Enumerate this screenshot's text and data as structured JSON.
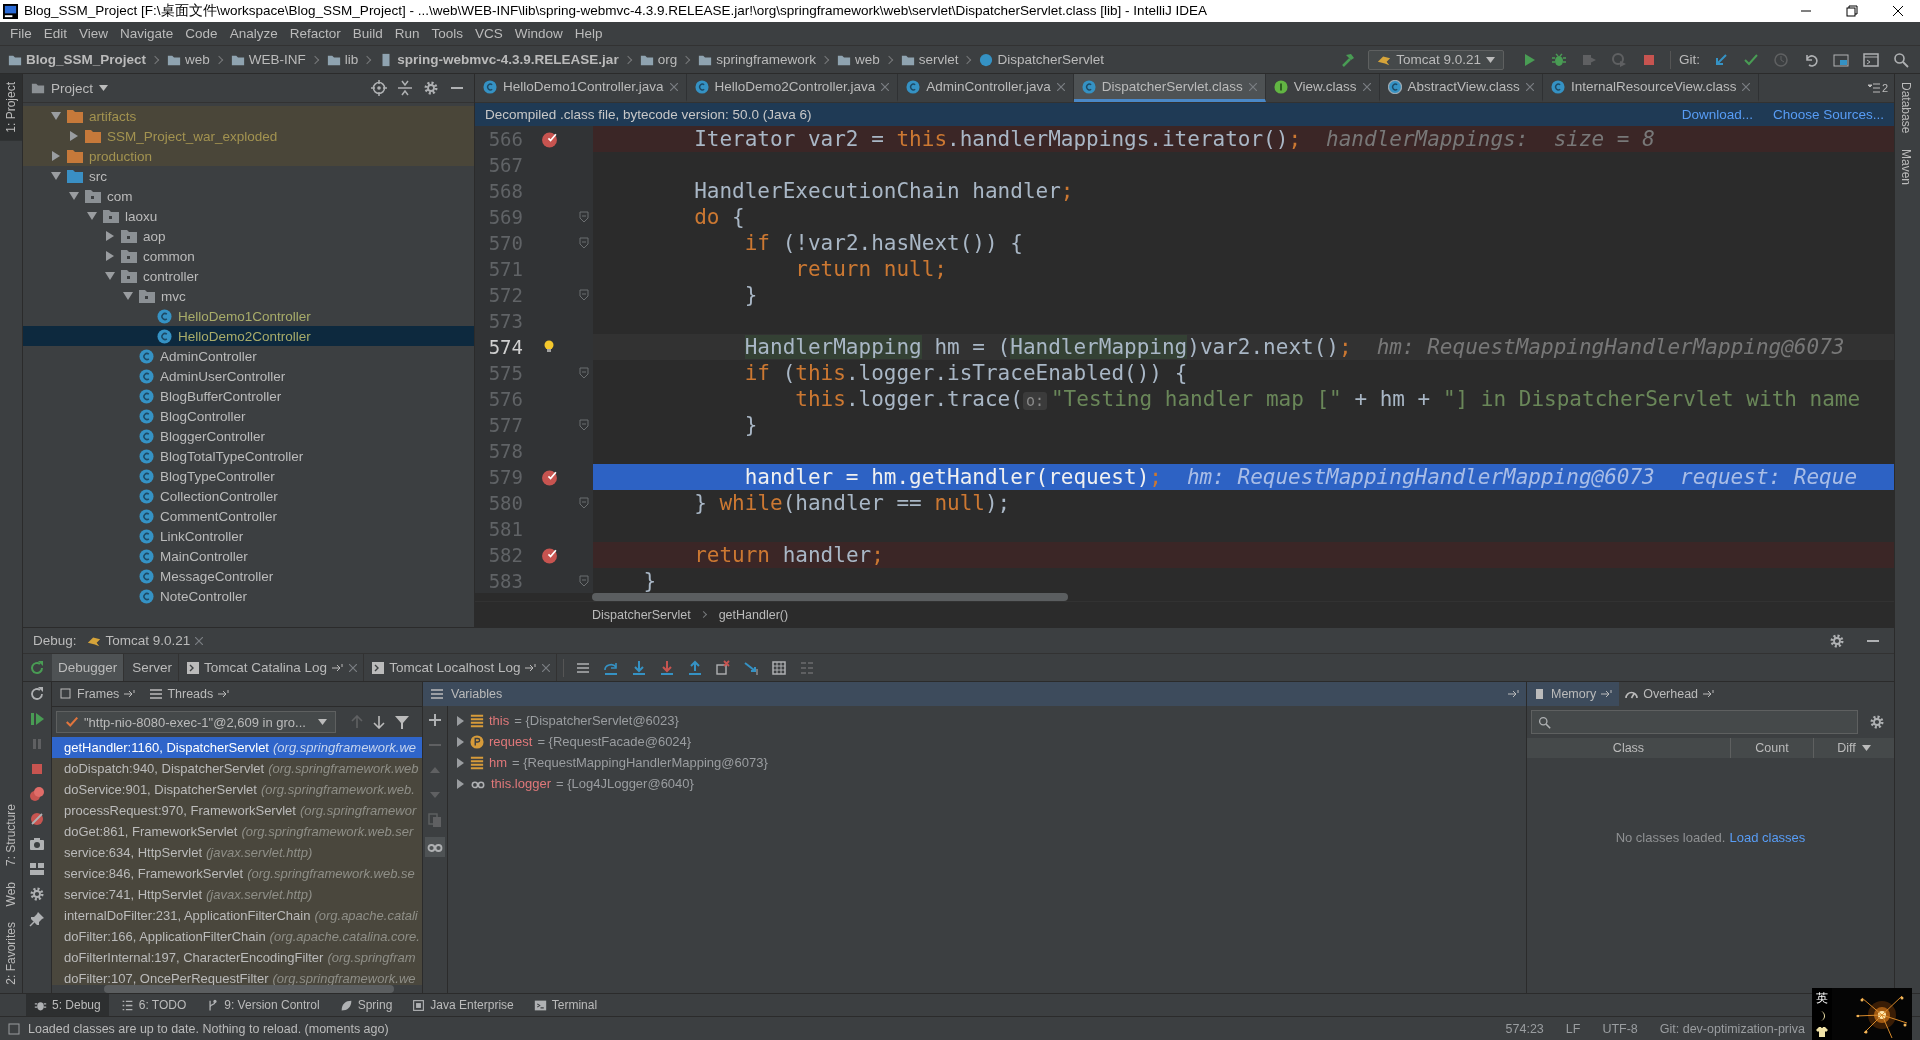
{
  "window": {
    "title": "Blog_SSM_Project [F:\\桌面文件\\workspace\\Blog_SSM_Project] - ...\\web\\WEB-INF\\lib\\spring-webmvc-4.3.9.RELEASE.jar!\\org\\springframework\\web\\servlet\\DispatcherServlet.class [lib] - IntelliJ IDEA"
  },
  "menu": [
    "File",
    "Edit",
    "View",
    "Navigate",
    "Code",
    "Analyze",
    "Refactor",
    "Build",
    "Run",
    "Tools",
    "VCS",
    "Window",
    "Help"
  ],
  "nav_bar": {
    "breadcrumbs": [
      {
        "label": "Blog_SSM_Project",
        "kind": "project"
      },
      {
        "label": "web",
        "kind": "folder"
      },
      {
        "label": "WEB-INF",
        "kind": "folder"
      },
      {
        "label": "lib",
        "kind": "folder"
      },
      {
        "label": "spring-webmvc-4.3.9.RELEASE.jar",
        "kind": "jar"
      },
      {
        "label": "org",
        "kind": "package"
      },
      {
        "label": "springframework",
        "kind": "package"
      },
      {
        "label": "web",
        "kind": "package"
      },
      {
        "label": "servlet",
        "kind": "package"
      },
      {
        "label": "DispatcherServlet",
        "kind": "class"
      }
    ],
    "run_config": "Tomcat 9.0.21",
    "run_actions": [
      {
        "kind": "run",
        "disabled": false
      },
      {
        "kind": "debug",
        "disabled": false
      },
      {
        "kind": "coverage",
        "disabled": true
      },
      {
        "kind": "profile",
        "disabled": true
      },
      {
        "kind": "stop",
        "disabled": false
      }
    ],
    "git_label": "Git:",
    "git_actions": [
      {
        "kind": "update",
        "disabled": false
      },
      {
        "kind": "commit",
        "disabled": false
      },
      {
        "kind": "history",
        "disabled": true
      },
      {
        "kind": "revert",
        "disabled": false
      },
      {
        "kind": "structure",
        "disabled": false
      },
      {
        "kind": "window",
        "disabled": false
      },
      {
        "kind": "search",
        "disabled": false
      }
    ]
  },
  "left_stripe": {
    "top": [
      {
        "label": "1: Project",
        "selected": true
      }
    ],
    "bottom": [
      {
        "label": "7: Structure",
        "selected": false
      },
      {
        "label": "Web",
        "selected": false
      },
      {
        "label": "2: Favorites",
        "selected": false
      }
    ]
  },
  "right_stripe": [
    {
      "label": "Database",
      "selected": false
    },
    {
      "label": "Maven",
      "selected": false
    }
  ],
  "project": {
    "title": "Project",
    "tree": [
      {
        "label": "artifacts",
        "kind": "excluded-folder",
        "expanded": true,
        "selected": false,
        "children": [
          {
            "label": "SSM_Project_war_exploded",
            "kind": "excluded-folder",
            "expanded": false,
            "selected": false
          }
        ]
      },
      {
        "label": "production",
        "kind": "excluded-folder",
        "expanded": false,
        "selected": false
      },
      {
        "label": "src",
        "kind": "source-folder",
        "expanded": true,
        "selected": false,
        "children": [
          {
            "label": "com",
            "kind": "package",
            "expanded": true,
            "selected": false,
            "children": [
              {
                "label": "laoxu",
                "kind": "package",
                "expanded": true,
                "selected": false,
                "children": [
                  {
                    "label": "aop",
                    "kind": "package",
                    "expanded": false,
                    "selected": false
                  },
                  {
                    "label": "common",
                    "kind": "package",
                    "expanded": false,
                    "selected": false
                  },
                  {
                    "label": "controller",
                    "kind": "package",
                    "expanded": true,
                    "selected": false,
                    "children": [
                      {
                        "label": "mvc",
                        "kind": "package",
                        "expanded": true,
                        "selected": false,
                        "children": [
                          {
                            "label": "HelloDemo1Controller",
                            "kind": "class",
                            "changed": true,
                            "selected": false
                          },
                          {
                            "label": "HelloDemo2Controller",
                            "kind": "class",
                            "changed": true,
                            "selected": true
                          }
                        ]
                      },
                      {
                        "label": "AdminController",
                        "kind": "class",
                        "changed": false,
                        "selected": false
                      },
                      {
                        "label": "AdminUserController",
                        "kind": "class",
                        "changed": false,
                        "selected": false
                      },
                      {
                        "label": "BlogBufferController",
                        "kind": "class",
                        "changed": false,
                        "selected": false
                      },
                      {
                        "label": "BlogController",
                        "kind": "class",
                        "changed": false,
                        "selected": false
                      },
                      {
                        "label": "BloggerController",
                        "kind": "class",
                        "changed": false,
                        "selected": false
                      },
                      {
                        "label": "BlogTotalTypeController",
                        "kind": "class",
                        "changed": false,
                        "selected": false
                      },
                      {
                        "label": "BlogTypeController",
                        "kind": "class",
                        "changed": false,
                        "selected": false
                      },
                      {
                        "label": "CollectionController",
                        "kind": "class",
                        "changed": false,
                        "selected": false
                      },
                      {
                        "label": "CommentController",
                        "kind": "class",
                        "changed": false,
                        "selected": false
                      },
                      {
                        "label": "LinkController",
                        "kind": "class",
                        "changed": false,
                        "selected": false
                      },
                      {
                        "label": "MainController",
                        "kind": "class",
                        "changed": false,
                        "selected": false
                      },
                      {
                        "label": "MessageController",
                        "kind": "class",
                        "changed": false,
                        "selected": false
                      },
                      {
                        "label": "NoteController",
                        "kind": "class",
                        "changed": false,
                        "selected": false
                      }
                    ]
                  }
                ]
              }
            ]
          }
        ]
      }
    ]
  },
  "editor": {
    "tabs": [
      {
        "label": "HelloDemo1Controller.java",
        "kind": "class",
        "selected": false
      },
      {
        "label": "HelloDemo2Controller.java",
        "kind": "class",
        "selected": false
      },
      {
        "label": "AdminController.java",
        "kind": "class",
        "selected": false
      },
      {
        "label": "DispatcherServlet.class",
        "kind": "class",
        "selected": true
      },
      {
        "label": "View.class",
        "kind": "interface",
        "selected": false
      },
      {
        "label": "AbstractView.class",
        "kind": "abstract",
        "selected": false
      },
      {
        "label": "InternalResourceView.class",
        "kind": "class",
        "selected": false
      }
    ],
    "tab_count": "2",
    "banner": {
      "text": "Decompiled .class file, bytecode version: 50.0 (Java 6)",
      "links": [
        "Download...",
        "Choose Sources..."
      ]
    },
    "lines": [
      {
        "number": "566",
        "breakpoint": true,
        "execution_point": false,
        "caret_line": false,
        "fold": false,
        "bulb": false,
        "tokens": [
          {
            "kind": "plain",
            "text": "        Iterator var2 = "
          },
          {
            "kind": "kw",
            "text": "this"
          },
          {
            "kind": "plain",
            "text": ".handlerMappings.iterator()"
          },
          {
            "kind": "kw",
            "text": ";"
          }
        ],
        "inline_value": "handlerMappings:  size = 8"
      },
      {
        "number": "567",
        "breakpoint": false,
        "execution_point": false,
        "caret_line": false,
        "fold": false,
        "bulb": false
      },
      {
        "number": "568",
        "breakpoint": false,
        "execution_point": false,
        "caret_line": false,
        "fold": false,
        "bulb": false,
        "tokens": [
          {
            "kind": "plain",
            "text": "        HandlerExecutionChain handler"
          },
          {
            "kind": "kw",
            "text": ";"
          }
        ]
      },
      {
        "number": "569",
        "breakpoint": false,
        "execution_point": false,
        "caret_line": false,
        "fold": true,
        "bulb": false,
        "tokens": [
          {
            "kind": "kw",
            "text": "        do"
          },
          {
            "kind": "plain",
            "text": " {"
          }
        ]
      },
      {
        "number": "570",
        "breakpoint": false,
        "execution_point": false,
        "caret_line": false,
        "fold": true,
        "bulb": false,
        "tokens": [
          {
            "kind": "kw",
            "text": "            if"
          },
          {
            "kind": "plain",
            "text": " (!var2.hasNext()) {"
          }
        ]
      },
      {
        "number": "571",
        "breakpoint": false,
        "execution_point": false,
        "caret_line": false,
        "fold": false,
        "bulb": false,
        "tokens": [
          {
            "kind": "kw",
            "text": "                return null;"
          }
        ]
      },
      {
        "number": "572",
        "breakpoint": false,
        "execution_point": false,
        "caret_line": false,
        "fold": true,
        "bulb": false,
        "tokens": [
          {
            "kind": "plain",
            "text": "            }"
          }
        ]
      },
      {
        "number": "573",
        "breakpoint": false,
        "execution_point": false,
        "caret_line": false,
        "fold": false,
        "bulb": false
      },
      {
        "number": "574",
        "breakpoint": false,
        "execution_point": false,
        "caret_line": true,
        "fold": false,
        "bulb": true,
        "tokens": [
          {
            "kind": "usage",
            "text": "            HandlerMapping"
          },
          {
            "kind": "plain",
            "text": " hm = ("
          },
          {
            "kind": "usage",
            "text": "HandlerMapping"
          },
          {
            "kind": "plain",
            "text": ")var2.next()"
          },
          {
            "kind": "kw",
            "text": ";"
          }
        ],
        "inline_value": "hm: RequestMappingHandlerMapping@6073"
      },
      {
        "number": "575",
        "breakpoint": false,
        "execution_point": false,
        "caret_line": false,
        "fold": true,
        "bulb": false,
        "tokens": [
          {
            "kind": "kw",
            "text": "            if"
          },
          {
            "kind": "plain",
            "text": " ("
          },
          {
            "kind": "kw",
            "text": "this"
          },
          {
            "kind": "plain",
            "text": ".logger.isTraceEnabled()) {"
          }
        ]
      },
      {
        "number": "576",
        "breakpoint": false,
        "execution_point": false,
        "caret_line": false,
        "fold": false,
        "bulb": false,
        "tokens": [
          {
            "kind": "kw",
            "text": "                this"
          },
          {
            "kind": "plain",
            "text": ".logger.trace("
          },
          {
            "kind": "chip",
            "text": "o:"
          },
          {
            "kind": "str",
            "text": "\"Testing handler map [\""
          },
          {
            "kind": "plain",
            "text": " + hm + "
          },
          {
            "kind": "str",
            "text": "\"] in DispatcherServlet with name"
          }
        ]
      },
      {
        "number": "577",
        "breakpoint": false,
        "execution_point": false,
        "caret_line": false,
        "fold": true,
        "bulb": false,
        "tokens": [
          {
            "kind": "plain",
            "text": "            }"
          }
        ]
      },
      {
        "number": "578",
        "breakpoint": false,
        "execution_point": false,
        "caret_line": false,
        "fold": false,
        "bulb": false
      },
      {
        "number": "579",
        "breakpoint": true,
        "execution_point": true,
        "caret_line": false,
        "fold": false,
        "bulb": false,
        "tokens": [
          {
            "kind": "plain",
            "text": "            handler = hm.getHandler(request)"
          },
          {
            "kind": "kw",
            "text": ";"
          }
        ],
        "inline_value": "hm: RequestMappingHandlerMapping@6073  request: Reque"
      },
      {
        "number": "580",
        "breakpoint": false,
        "execution_point": false,
        "caret_line": false,
        "fold": true,
        "bulb": false,
        "tokens": [
          {
            "kind": "plain",
            "text": "        } "
          },
          {
            "kind": "kw",
            "text": "while"
          },
          {
            "kind": "plain",
            "text": "(handler == "
          },
          {
            "kind": "kw",
            "text": "null"
          },
          {
            "kind": "plain",
            "text": ");"
          }
        ]
      },
      {
        "number": "581",
        "breakpoint": false,
        "execution_point": false,
        "caret_line": false,
        "fold": false,
        "bulb": false
      },
      {
        "number": "582",
        "breakpoint": true,
        "execution_point": false,
        "caret_line": false,
        "fold": false,
        "bulb": false,
        "tokens": [
          {
            "kind": "kw",
            "text": "        return"
          },
          {
            "kind": "plain",
            "text": " handler"
          },
          {
            "kind": "kw",
            "text": ";"
          }
        ]
      },
      {
        "number": "583",
        "breakpoint": false,
        "execution_point": false,
        "caret_line": false,
        "fold": true,
        "bulb": false,
        "tokens": [
          {
            "kind": "plain",
            "text": "    }"
          }
        ]
      }
    ],
    "breadcrumbs": [
      "DispatcherServlet",
      "getHandler()"
    ]
  },
  "debug": {
    "label": "Debug:",
    "session": "Tomcat 9.0.21",
    "tabs": [
      {
        "label": "Debugger",
        "kind": "plain",
        "selected": true
      },
      {
        "label": "Server",
        "kind": "plain",
        "selected": false
      },
      {
        "label": "Tomcat Catalina Log",
        "kind": "log",
        "selected": false
      },
      {
        "label": "Tomcat Localhost Log",
        "kind": "log",
        "selected": false
      }
    ],
    "step_actions": [
      {
        "kind": "show-point",
        "disabled": false
      },
      {
        "kind": "step-over",
        "disabled": false
      },
      {
        "kind": "step-into",
        "disabled": false
      },
      {
        "kind": "force-step-into",
        "disabled": false
      },
      {
        "kind": "step-out",
        "disabled": false
      },
      {
        "kind": "drop-frame",
        "disabled": false
      },
      {
        "kind": "run-to-cursor",
        "disabled": false
      },
      {
        "kind": "evaluate",
        "disabled": false
      },
      {
        "kind": "trace",
        "disabled": true
      }
    ],
    "side_actions": [
      {
        "kind": "rerun",
        "disabled": false
      },
      {
        "kind": "refresh",
        "disabled": false
      },
      {
        "kind": "resume",
        "disabled": false
      },
      {
        "kind": "pause",
        "disabled": true
      },
      {
        "kind": "stop",
        "disabled": false
      },
      {
        "kind": "breakpoints",
        "disabled": false
      },
      {
        "kind": "mute",
        "disabled": false
      },
      {
        "kind": "camera",
        "disabled": false
      },
      {
        "kind": "layout",
        "disabled": false
      },
      {
        "kind": "settings",
        "disabled": false
      },
      {
        "kind": "pin",
        "disabled": false
      }
    ],
    "frames_tabs": [
      "Frames",
      "Threads"
    ],
    "thread": "\"http-nio-8080-exec-1\"@2,609 in gro...",
    "frames": [
      {
        "method": "getHandler:1160, DispatcherServlet",
        "package": "(org.springframework.we",
        "selected": true
      },
      {
        "method": "doDispatch:940, DispatcherServlet",
        "package": "(org.springframework.web",
        "selected": false
      },
      {
        "method": "doService:901, DispatcherServlet",
        "package": "(org.springframework.web.",
        "selected": false
      },
      {
        "method": "processRequest:970, FrameworkServlet",
        "package": "(org.springframewor",
        "selected": false
      },
      {
        "method": "doGet:861, FrameworkServlet",
        "package": "(org.springframework.web.ser",
        "selected": false
      },
      {
        "method": "service:634, HttpServlet",
        "package": "(javax.servlet.http)",
        "selected": false
      },
      {
        "method": "service:846, FrameworkServlet",
        "package": "(org.springframework.web.se",
        "selected": false
      },
      {
        "method": "service:741, HttpServlet",
        "package": "(javax.servlet.http)",
        "selected": false
      },
      {
        "method": "internalDoFilter:231, ApplicationFilterChain",
        "package": "(org.apache.catali",
        "selected": false
      },
      {
        "method": "doFilter:166, ApplicationFilterChain",
        "package": "(org.apache.catalina.core.",
        "selected": false
      },
      {
        "method": "doFilterInternal:197, CharacterEncodingFilter",
        "package": "(org.springfram",
        "selected": false
      },
      {
        "method": "doFilter:107, OncePerRequestFilter",
        "package": "(org.springframework.we",
        "selected": false
      }
    ],
    "variables_title": "Variables",
    "var_actions": [
      {
        "kind": "add",
        "disabled": false
      },
      {
        "kind": "remove",
        "disabled": true
      },
      {
        "kind": "up",
        "disabled": true
      },
      {
        "kind": "down",
        "disabled": true
      },
      {
        "kind": "copy",
        "disabled": true
      },
      {
        "kind": "watch",
        "disabled": false
      }
    ],
    "variables": [
      {
        "name": "this",
        "value": "= {DispatcherServlet@6023}",
        "kind": "field"
      },
      {
        "name": "request",
        "value": "= {RequestFacade@6024}",
        "kind": "parameter"
      },
      {
        "name": "hm",
        "value": "= {RequestMappingHandlerMapping@6073}",
        "kind": "field"
      },
      {
        "name": "this.logger",
        "value": "= {Log4JLogger@6040}",
        "kind": "watch"
      }
    ],
    "memory": {
      "tabs": [
        "Memory",
        "Overhead"
      ],
      "columns": [
        "Class",
        "Count",
        "Diff"
      ],
      "empty_text": "No classes loaded.",
      "link": "Load classes"
    }
  },
  "tool_windows": [
    {
      "label": "5: Debug",
      "kind": "debug",
      "selected": true
    },
    {
      "label": "6: TODO",
      "kind": "todo",
      "selected": false
    },
    {
      "label": "9: Version Control",
      "kind": "vcs",
      "selected": false
    },
    {
      "label": "Spring",
      "kind": "spring",
      "selected": false
    },
    {
      "label": "Java Enterprise",
      "kind": "enterprise",
      "selected": false
    },
    {
      "label": "Terminal",
      "kind": "terminal",
      "selected": false
    }
  ],
  "status": {
    "message": "Loaded classes are up to date. Nothing to reload. (moments ago)",
    "items": [
      "574:23",
      "LF",
      "UTF-8",
      "Git: dev-optimization-priva"
    ]
  },
  "ime": {
    "label": "英"
  }
}
